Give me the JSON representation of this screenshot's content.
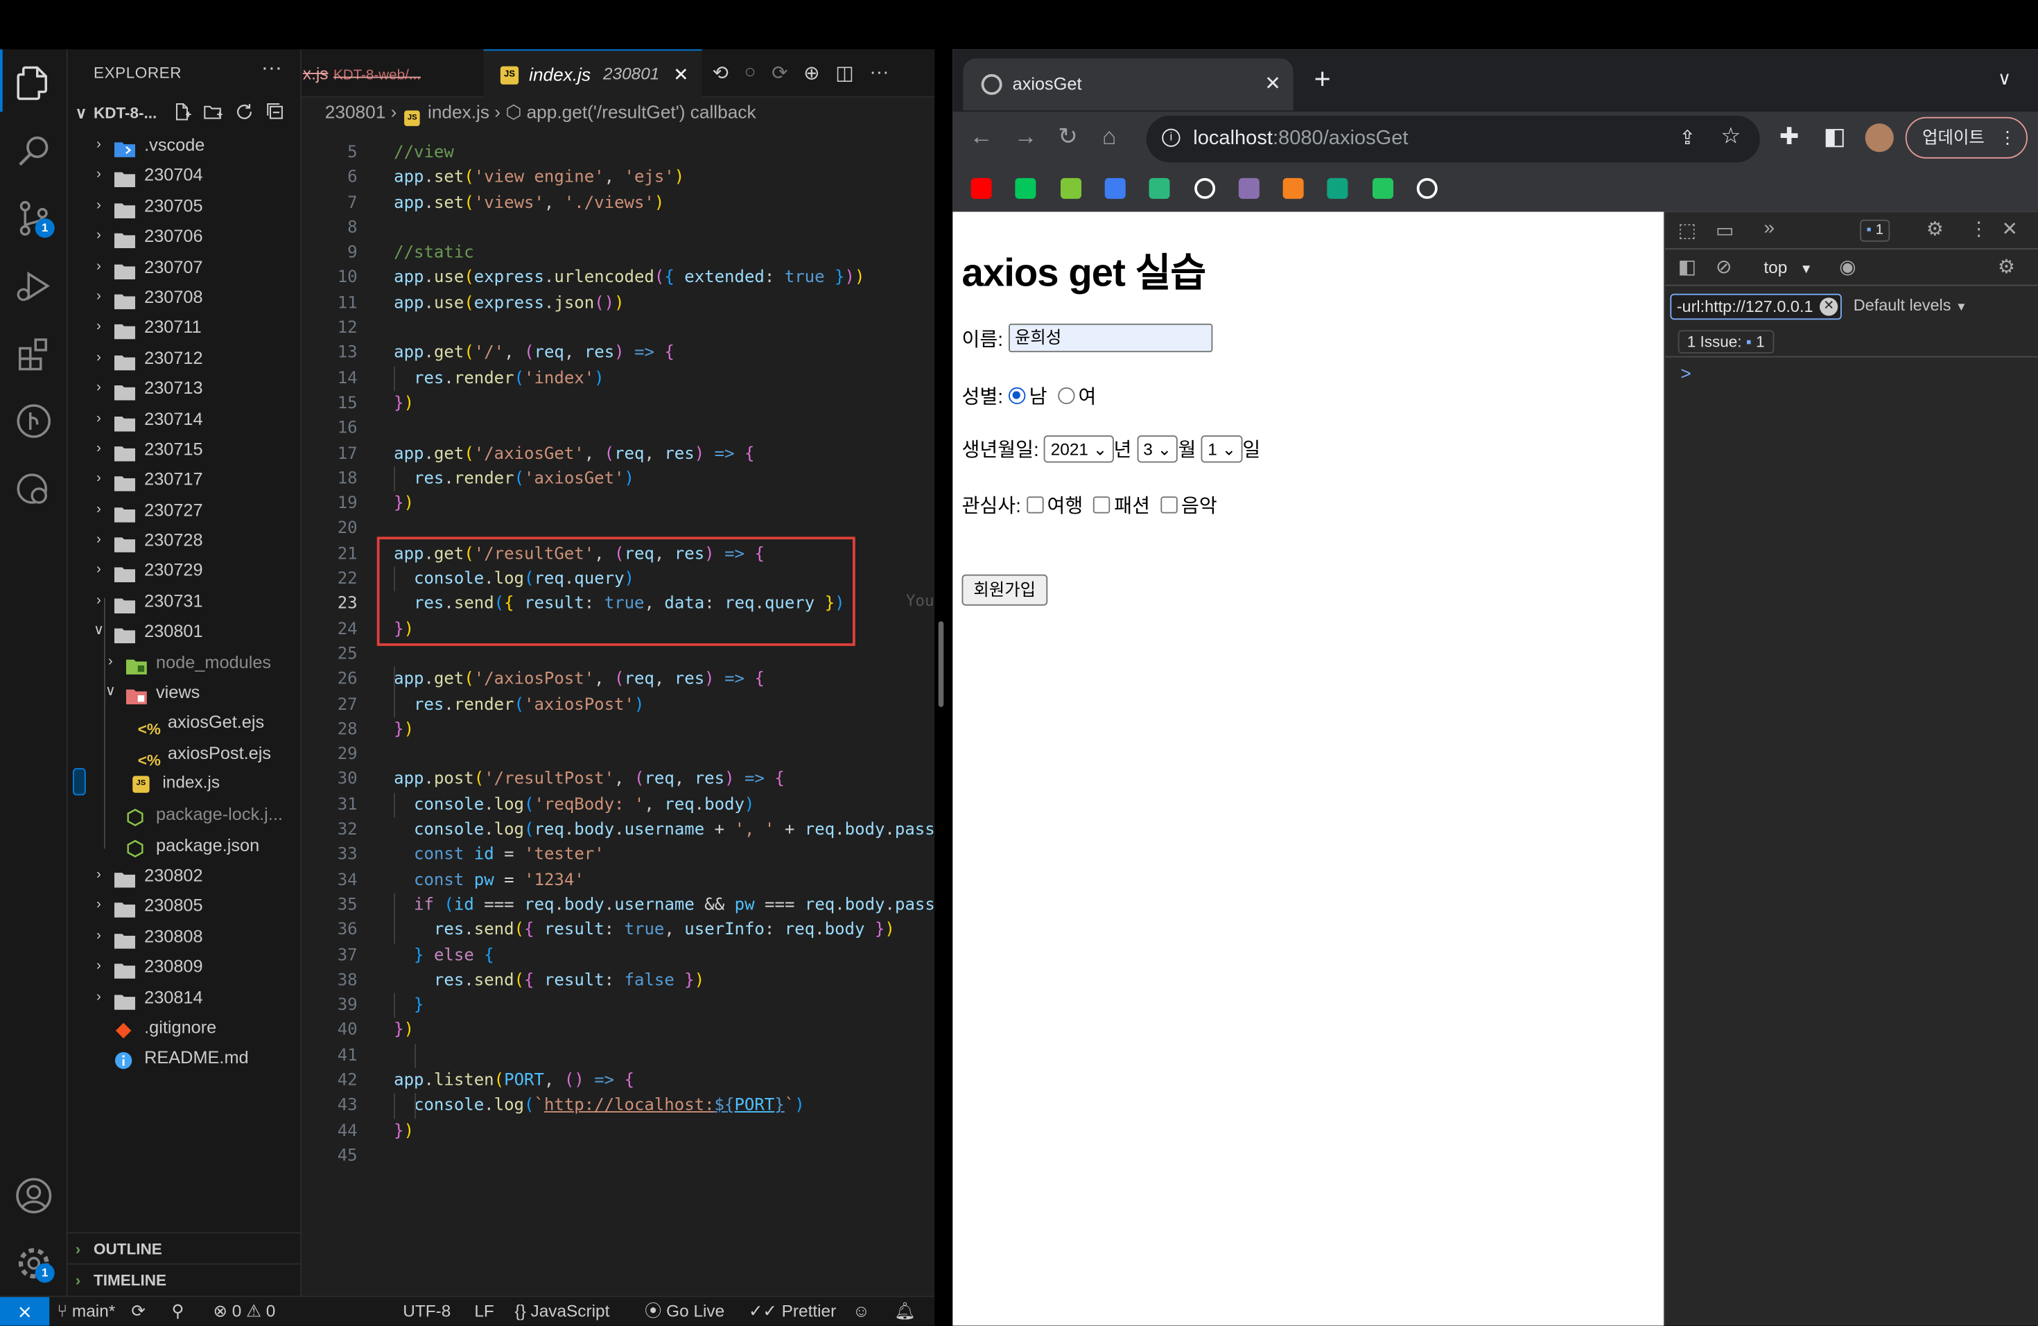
{
  "vscode": {
    "explorer_title": "EXPLORER",
    "workspace_name": "KDT-8-...",
    "tree": [
      {
        "label": ".vscode",
        "indent": 0,
        "kind": "folder-vscode",
        "open": false
      },
      {
        "label": "230704",
        "indent": 0,
        "kind": "folder",
        "open": false
      },
      {
        "label": "230705",
        "indent": 0,
        "kind": "folder",
        "open": false
      },
      {
        "label": "230706",
        "indent": 0,
        "kind": "folder",
        "open": false
      },
      {
        "label": "230707",
        "indent": 0,
        "kind": "folder",
        "open": false
      },
      {
        "label": "230708",
        "indent": 0,
        "kind": "folder",
        "open": false
      },
      {
        "label": "230711",
        "indent": 0,
        "kind": "folder",
        "open": false
      },
      {
        "label": "230712",
        "indent": 0,
        "kind": "folder",
        "open": false
      },
      {
        "label": "230713",
        "indent": 0,
        "kind": "folder",
        "open": false
      },
      {
        "label": "230714",
        "indent": 0,
        "kind": "folder",
        "open": false
      },
      {
        "label": "230715",
        "indent": 0,
        "kind": "folder",
        "open": false
      },
      {
        "label": "230717",
        "indent": 0,
        "kind": "folder",
        "open": false
      },
      {
        "label": "230727",
        "indent": 0,
        "kind": "folder",
        "open": false
      },
      {
        "label": "230728",
        "indent": 0,
        "kind": "folder",
        "open": false
      },
      {
        "label": "230729",
        "indent": 0,
        "kind": "folder",
        "open": false
      },
      {
        "label": "230731",
        "indent": 0,
        "kind": "folder",
        "open": false
      },
      {
        "label": "230801",
        "indent": 0,
        "kind": "folder",
        "open": true
      },
      {
        "label": "node_modules",
        "indent": 1,
        "kind": "folder-node",
        "open": false,
        "dim": true
      },
      {
        "label": "views",
        "indent": 1,
        "kind": "folder-views",
        "open": true
      },
      {
        "label": "axiosGet.ejs",
        "indent": 2,
        "kind": "ejs"
      },
      {
        "label": "axiosPost.ejs",
        "indent": 2,
        "kind": "ejs"
      },
      {
        "label": "index.js",
        "indent": 1,
        "kind": "js",
        "selected": true
      },
      {
        "label": "package-lock.j...",
        "indent": 1,
        "kind": "npm",
        "dim": true
      },
      {
        "label": "package.json",
        "indent": 1,
        "kind": "npm"
      },
      {
        "label": "230802",
        "indent": 0,
        "kind": "folder",
        "open": false
      },
      {
        "label": "230805",
        "indent": 0,
        "kind": "folder",
        "open": false
      },
      {
        "label": "230808",
        "indent": 0,
        "kind": "folder",
        "open": false
      },
      {
        "label": "230809",
        "indent": 0,
        "kind": "folder",
        "open": false
      },
      {
        "label": "230814",
        "indent": 0,
        "kind": "folder",
        "open": false
      },
      {
        "label": ".gitignore",
        "indent": 0,
        "kind": "git"
      },
      {
        "label": "README.md",
        "indent": 0,
        "kind": "info"
      }
    ],
    "outline_label": "OUTLINE",
    "timeline_label": "TIMELINE",
    "tab_prev_ext": "x.js",
    "tab_prev_folder": "KDT-8-web/...",
    "tab_active_name": "index.js",
    "tab_active_folder": "230801",
    "breadcrumb_folder": "230801",
    "breadcrumb_file": "index.js",
    "breadcrumb_symbol": "app.get('/resultGet') callback",
    "blame_hint": "You",
    "status": {
      "branch": "main*",
      "errors": "0",
      "warnings": "0",
      "encoding": "UTF-8",
      "eol": "LF",
      "language": "JavaScript",
      "golive": "Go Live",
      "prettier": "Prettier"
    },
    "badges": {
      "scm": "1",
      "settings": "1"
    },
    "colors": {
      "accent": "#0078d4",
      "highlight_box": "#e0403a"
    }
  },
  "code_lines": [
    {
      "n": "5",
      "h": "<span class=\"c\">//view</span>"
    },
    {
      "n": "6",
      "h": "<span class=\"k\">app</span>.<span class=\"f\">set</span><span class=\"p1\">(</span><span class=\"s\">'view engine'</span>, <span class=\"s\">'ejs'</span><span class=\"p1\">)</span>"
    },
    {
      "n": "7",
      "h": "<span class=\"k\">app</span>.<span class=\"f\">set</span><span class=\"p1\">(</span><span class=\"s\">'views'</span>, <span class=\"s\">'./views'</span><span class=\"p1\">)</span>"
    },
    {
      "n": "8",
      "h": ""
    },
    {
      "n": "9",
      "h": "<span class=\"c\">//static</span>"
    },
    {
      "n": "10",
      "h": "<span class=\"k\">app</span>.<span class=\"f\">use</span><span class=\"p1\">(</span><span class=\"k\">express</span>.<span class=\"f\">urlencoded</span><span class=\"p2\">(</span><span class=\"p3\">{</span> <span class=\"pr\">extended</span>: <span class=\"kb\">true</span> <span class=\"p3\">}</span><span class=\"p2\">)</span><span class=\"p1\">)</span>"
    },
    {
      "n": "11",
      "h": "<span class=\"k\">app</span>.<span class=\"f\">use</span><span class=\"p1\">(</span><span class=\"k\">express</span>.<span class=\"f\">json</span><span class=\"p2\">()</span><span class=\"p1\">)</span>"
    },
    {
      "n": "12",
      "h": ""
    },
    {
      "n": "13",
      "h": "<span class=\"k\">app</span>.<span class=\"f\">get</span><span class=\"p1\">(</span><span class=\"s\">'/'</span>, <span class=\"p2\">(</span><span class=\"k\">req</span>, <span class=\"k\">res</span><span class=\"p2\">)</span> <span class=\"kb\">=&gt;</span> <span class=\"p2\">{</span>"
    },
    {
      "n": "14",
      "h": "  <span class=\"k\">res</span>.<span class=\"f\">render</span><span class=\"p3\">(</span><span class=\"s\">'index'</span><span class=\"p3\">)</span>"
    },
    {
      "n": "15",
      "h": "<span class=\"p2\">}</span><span class=\"p1\">)</span>"
    },
    {
      "n": "16",
      "h": ""
    },
    {
      "n": "17",
      "h": "<span class=\"k\">app</span>.<span class=\"f\">get</span><span class=\"p1\">(</span><span class=\"s\">'/axiosGet'</span>, <span class=\"p2\">(</span><span class=\"k\">req</span>, <span class=\"k\">res</span><span class=\"p2\">)</span> <span class=\"kb\">=&gt;</span> <span class=\"p2\">{</span>"
    },
    {
      "n": "18",
      "h": "  <span class=\"k\">res</span>.<span class=\"f\">render</span><span class=\"p3\">(</span><span class=\"s\">'axiosGet'</span><span class=\"p3\">)</span>"
    },
    {
      "n": "19",
      "h": "<span class=\"p2\">}</span><span class=\"p1\">)</span>"
    },
    {
      "n": "20",
      "h": ""
    },
    {
      "n": "21",
      "h": "<span class=\"k\">app</span>.<span class=\"f\">get</span><span class=\"p1\">(</span><span class=\"s\">'/resultGet'</span>, <span class=\"p2\">(</span><span class=\"k\">req</span>, <span class=\"k\">res</span><span class=\"p2\">)</span> <span class=\"kb\">=&gt;</span> <span class=\"p2\">{</span>"
    },
    {
      "n": "22",
      "h": "  <span class=\"k\">console</span>.<span class=\"f\">log</span><span class=\"p3\">(</span><span class=\"k\">req</span>.<span class=\"k\">query</span><span class=\"p3\">)</span>"
    },
    {
      "n": "23",
      "h": "  <span class=\"k\">res</span>.<span class=\"f\">send</span><span class=\"p3\">(</span><span class=\"p1\">{</span> <span class=\"pr\">result</span>: <span class=\"kb\">true</span>, <span class=\"pr\">data</span>: <span class=\"k\">req</span>.<span class=\"k\">query</span> <span class=\"p1\">}</span><span class=\"p3\">)</span>",
      "cur": true
    },
    {
      "n": "24",
      "h": "<span class=\"p2\">}</span><span class=\"p1\">)</span>"
    },
    {
      "n": "25",
      "h": ""
    },
    {
      "n": "26",
      "h": "<span class=\"k\">app</span>.<span class=\"f\">get</span><span class=\"p1\">(</span><span class=\"s\">'/axiosPost'</span>, <span class=\"p2\">(</span><span class=\"k\">req</span>, <span class=\"k\">res</span><span class=\"p2\">)</span> <span class=\"kb\">=&gt;</span> <span class=\"p2\">{</span>"
    },
    {
      "n": "27",
      "h": "  <span class=\"k\">res</span>.<span class=\"f\">render</span><span class=\"p3\">(</span><span class=\"s\">'axiosPost'</span><span class=\"p3\">)</span>"
    },
    {
      "n": "28",
      "h": "<span class=\"p2\">}</span><span class=\"p1\">)</span>"
    },
    {
      "n": "29",
      "h": ""
    },
    {
      "n": "30",
      "h": "<span class=\"k\">app</span>.<span class=\"f\">post</span><span class=\"p1\">(</span><span class=\"s\">'/resultPost'</span>, <span class=\"p2\">(</span><span class=\"k\">req</span>, <span class=\"k\">res</span><span class=\"p2\">)</span> <span class=\"kb\">=&gt;</span> <span class=\"p2\">{</span>"
    },
    {
      "n": "31",
      "h": "  <span class=\"k\">console</span>.<span class=\"f\">log</span><span class=\"p3\">(</span><span class=\"s\">'reqBody: '</span>, <span class=\"k\">req</span>.<span class=\"k\">body</span><span class=\"p3\">)</span>"
    },
    {
      "n": "32",
      "h": "  <span class=\"k\">console</span>.<span class=\"f\">log</span><span class=\"p3\">(</span><span class=\"k\">req</span>.<span class=\"k\">body</span>.<span class=\"k\">username</span> <span class=\"op\">+</span> <span class=\"s\">', '</span> <span class=\"op\">+</span> <span class=\"k\">req</span>.<span class=\"k\">body</span>.<span class=\"k\">pass</span>"
    },
    {
      "n": "33",
      "h": "  <span class=\"kb\">const</span> <span class=\"cn\">id</span> <span class=\"op\">=</span> <span class=\"s\">'tester'</span>"
    },
    {
      "n": "34",
      "h": "  <span class=\"kb\">const</span> <span class=\"cn\">pw</span> <span class=\"op\">=</span> <span class=\"s\">'1234'</span>"
    },
    {
      "n": "35",
      "h": "  <span class=\"pu\">if</span> <span class=\"p3\">(</span><span class=\"cn\">id</span> <span class=\"op\">===</span> <span class=\"k\">req</span>.<span class=\"k\">body</span>.<span class=\"k\">username</span> <span class=\"op\">&amp;&amp;</span> <span class=\"cn\">pw</span> <span class=\"op\">===</span> <span class=\"k\">req</span>.<span class=\"k\">body</span>.<span class=\"k\">pass</span>"
    },
    {
      "n": "36",
      "h": "    <span class=\"k\">res</span>.<span class=\"f\">send</span><span class=\"p1\">(</span><span class=\"p2\">{</span> <span class=\"pr\">result</span>: <span class=\"kb\">true</span>, <span class=\"pr\">userInfo</span>: <span class=\"k\">req</span>.<span class=\"k\">body</span> <span class=\"p2\">}</span><span class=\"p1\">)</span>"
    },
    {
      "n": "37",
      "h": "  <span class=\"p3\">}</span> <span class=\"pu\">else</span> <span class=\"p3\">{</span>"
    },
    {
      "n": "38",
      "h": "    <span class=\"k\">res</span>.<span class=\"f\">send</span><span class=\"p1\">(</span><span class=\"p2\">{</span> <span class=\"pr\">result</span>: <span class=\"kb\">false</span> <span class=\"p2\">}</span><span class=\"p1\">)</span>"
    },
    {
      "n": "39",
      "h": "  <span class=\"p3\">}</span>"
    },
    {
      "n": "40",
      "h": "<span class=\"p2\">}</span><span class=\"p1\">)</span>"
    },
    {
      "n": "41",
      "h": ""
    },
    {
      "n": "42",
      "h": "<span class=\"k\">app</span>.<span class=\"f\">listen</span><span class=\"p1\">(</span><span class=\"cn\">PORT</span>, <span class=\"p2\">()</span> <span class=\"kb\">=&gt;</span> <span class=\"p2\">{</span>"
    },
    {
      "n": "43",
      "h": "  <span class=\"k\">console</span>.<span class=\"f\">log</span><span class=\"p3\">(</span><span class=\"s\">`<u>http://localhost:</u></span><span class=\"kb\"><u>${</u></span><span class=\"cn\"><u>PORT</u></span><span class=\"kb\"><u>}</u></span><span class=\"s\">`</span><span class=\"p3\">)</span>"
    },
    {
      "n": "44",
      "h": "<span class=\"p2\">}</span><span class=\"p1\">)</span>"
    },
    {
      "n": "45",
      "h": ""
    }
  ],
  "browser": {
    "tab_title": "axiosGet",
    "url_host": "localhost",
    "url_rest": ":8080/axiosGet",
    "update_button": "업데이트",
    "bookmark_colors": [
      "#ff0000",
      "#03c75a",
      "#7ec636",
      "#3e7cf2",
      "#2db87d",
      "#ffffff",
      "#8a6fb0",
      "#f5821f",
      "#10a37f",
      "#22c55e",
      "#ffffff"
    ],
    "page": {
      "heading": "axios get 실습",
      "name_label": "이름:",
      "name_value": "윤희성",
      "gender_label": "성별:",
      "gender_male": "남",
      "gender_female": "여",
      "birth_label": "생년월일:",
      "year_value": "2021",
      "year_unit": "년",
      "month_value": "3",
      "month_unit": "월",
      "day_value": "1",
      "day_unit": "일",
      "interest_label": "관심사:",
      "interest_1": "여행",
      "interest_2": "패션",
      "interest_3": "음악",
      "submit_label": "회원가입"
    },
    "devtools": {
      "message_badge": "1",
      "context": "top",
      "filter_value": "-url:http://127.0.0.1",
      "levels": "Default levels",
      "issues_label": "1 Issue:",
      "issues_count": "1",
      "prompt": ">"
    }
  }
}
